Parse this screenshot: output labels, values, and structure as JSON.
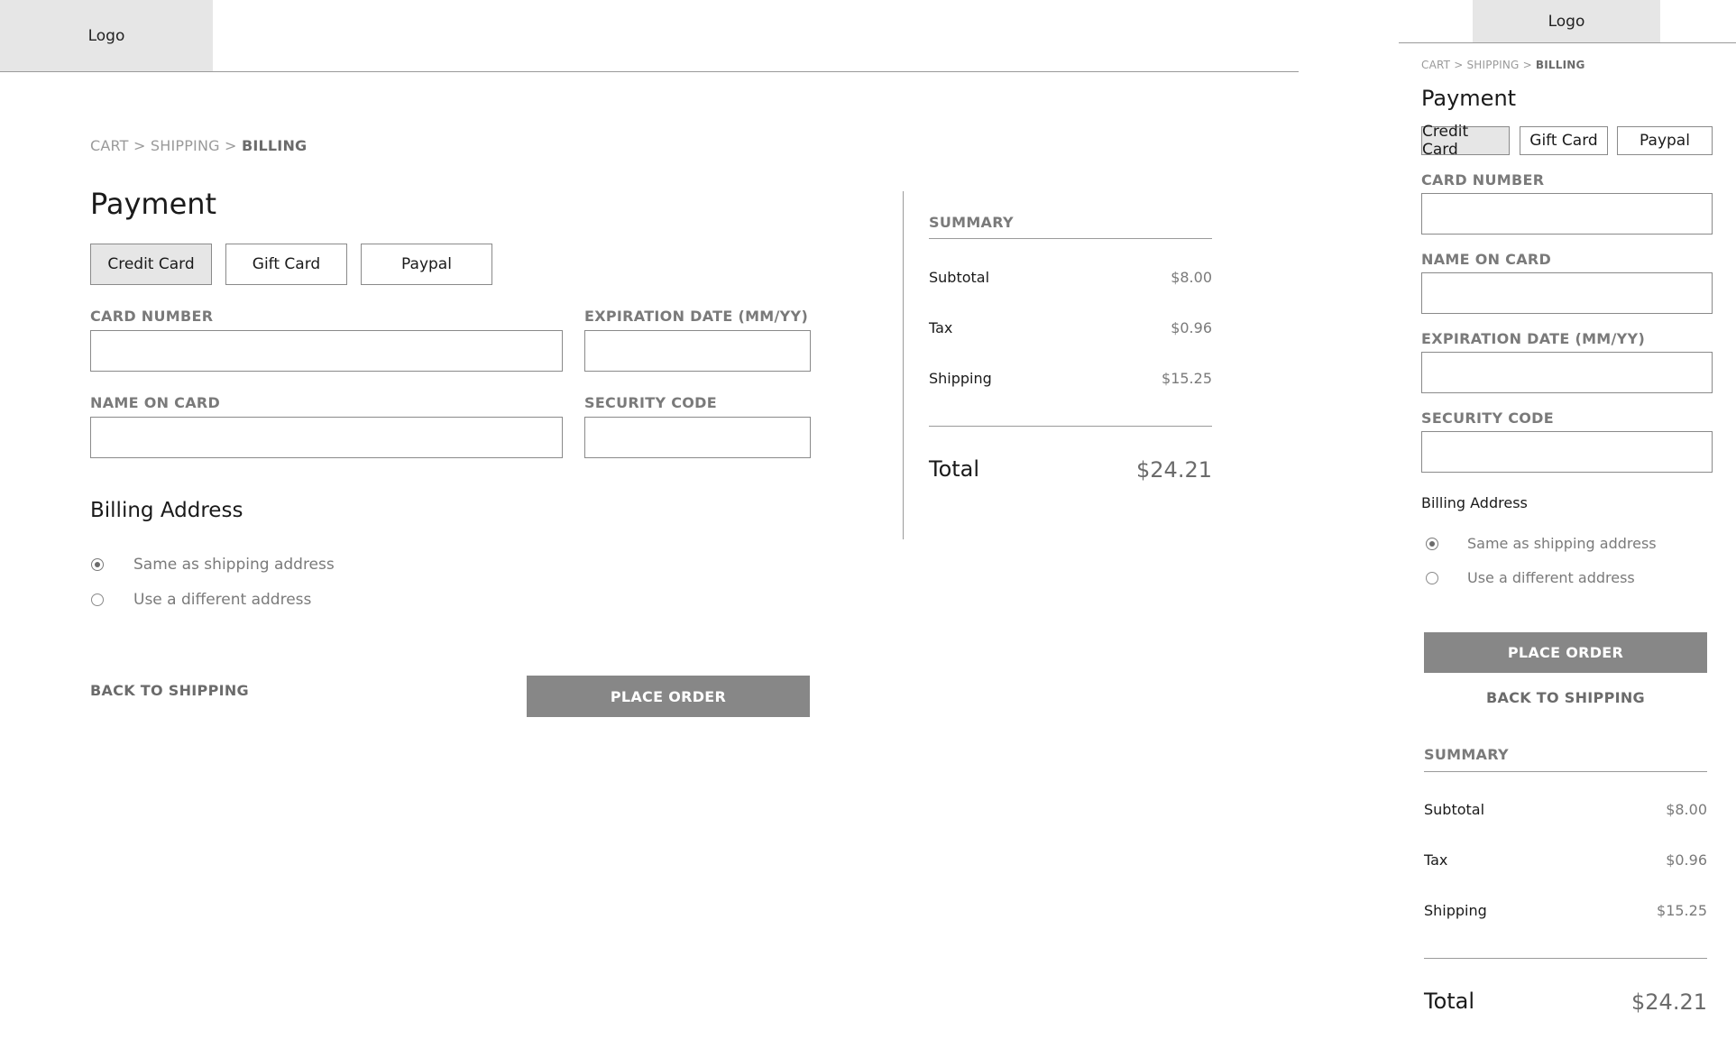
{
  "logo": "Logo",
  "breadcrumb": {
    "cart": "CART",
    "sep": ">",
    "shipping": "SHIPPING",
    "billing": "BILLING"
  },
  "payment": {
    "title": "Payment",
    "tabs": [
      "Credit Card",
      "Gift Card",
      "Paypal"
    ],
    "fields": {
      "card_number": "CARD NUMBER",
      "expiration": "EXPIRATION DATE (MM/YY)",
      "name_on_card": "NAME ON CARD",
      "security_code": "SECURITY CODE"
    }
  },
  "billing": {
    "title": "Billing Address",
    "options": [
      "Same as shipping address",
      "Use a different address"
    ]
  },
  "actions": {
    "back": "BACK TO SHIPPING",
    "place_order": "PLACE ORDER"
  },
  "summary": {
    "title": "SUMMARY",
    "rows": [
      {
        "label": "Subtotal",
        "value": "$8.00"
      },
      {
        "label": "Tax",
        "value": "$0.96"
      },
      {
        "label": "Shipping",
        "value": "$15.25"
      }
    ],
    "total_label": "Total",
    "total_value": "$24.21"
  }
}
